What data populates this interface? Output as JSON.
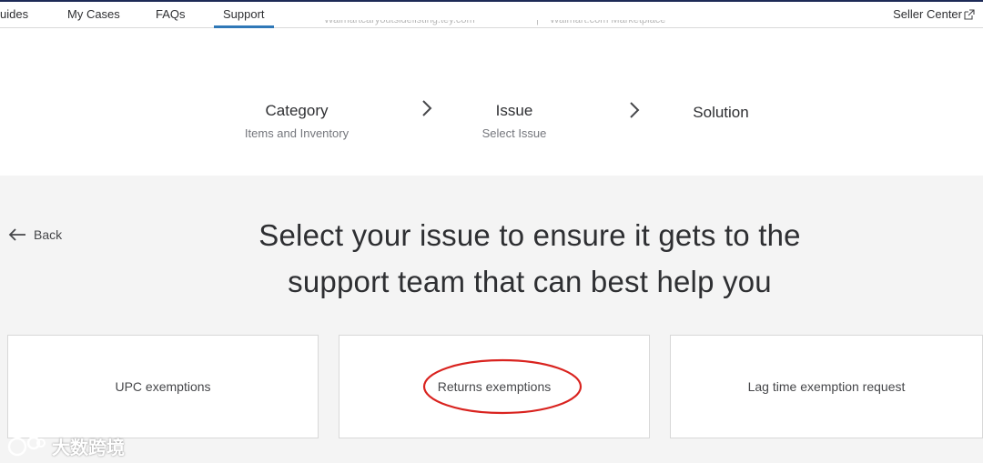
{
  "nav": {
    "tabs": [
      {
        "label": "uides"
      },
      {
        "label": "My Cases"
      },
      {
        "label": "FAQs"
      },
      {
        "label": "Support"
      }
    ],
    "active_tab": "Support",
    "seller_center_label": "Seller Center",
    "accent_color": "#2f78b7"
  },
  "header_cut_text": {
    "left": "Walmartcaryoutsidelisting.tey.com",
    "right": "Walmart.com Marketplace"
  },
  "steps": [
    {
      "title": "Category",
      "subtitle": "Items and Inventory"
    },
    {
      "title": "Issue",
      "subtitle": "Select Issue"
    },
    {
      "title": "Solution",
      "subtitle": ""
    }
  ],
  "back_label": "Back",
  "headline": {
    "line1": "Select your issue to ensure it gets to the",
    "line2": "support team that can best help you"
  },
  "options": [
    {
      "label": "UPC exemptions"
    },
    {
      "label": "Returns exemptions",
      "highlighted": true
    },
    {
      "label": "Lag time exemption request"
    }
  ],
  "annotation_color": "#d9231f",
  "watermark_text": "大数跨境"
}
